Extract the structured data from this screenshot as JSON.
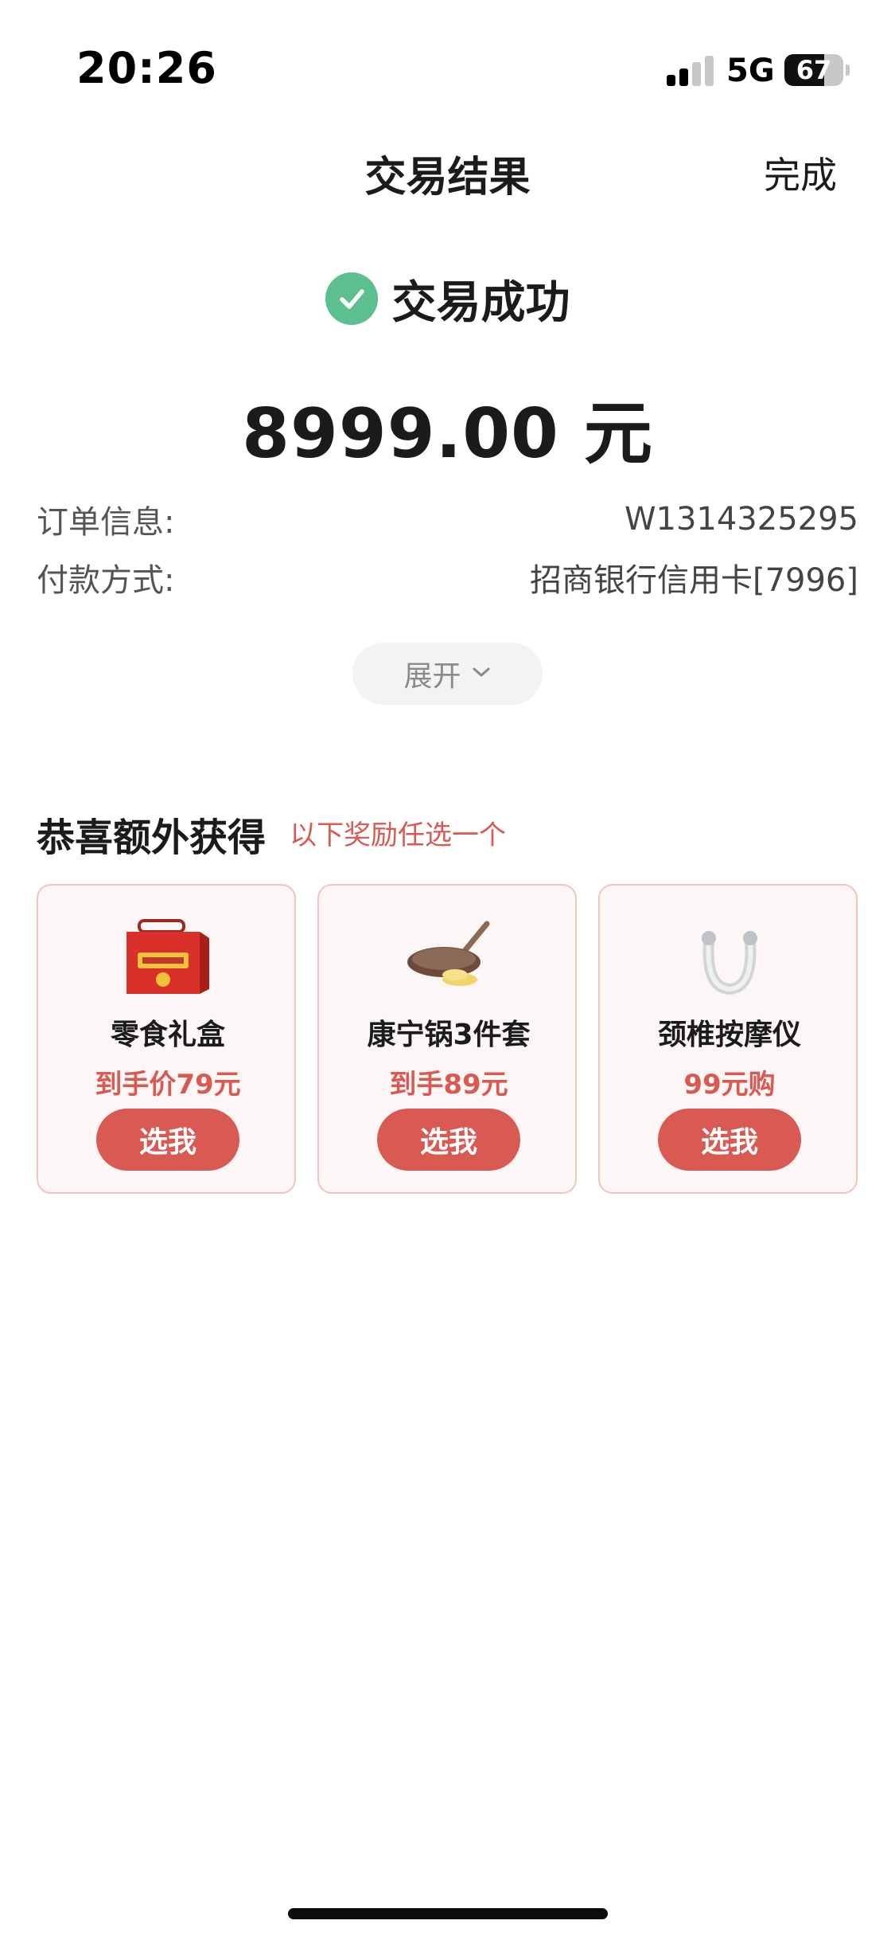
{
  "status_bar": {
    "time": "20:26",
    "network": "5G",
    "battery": "67",
    "battery_level_percent": 67
  },
  "nav": {
    "title": "交易结果",
    "done_label": "完成"
  },
  "result": {
    "status_text": "交易成功",
    "amount": "8999.00 元",
    "success_color": "#5cbf8f"
  },
  "info": {
    "order_label": "订单信息:",
    "order_value": "W1314325295",
    "payment_label": "付款方式:",
    "payment_value": "招商银行信用卡[7996]"
  },
  "expand": {
    "label": "展开",
    "icon": "chevron-down-icon"
  },
  "rewards": {
    "title": "恭喜额外获得",
    "subtitle": "以下奖励任选一个",
    "accent_color": "#d95a52",
    "items": [
      {
        "name": "零食礼盒",
        "price": "到手价79元",
        "button": "选我",
        "image": "snack-gift-box-image"
      },
      {
        "name": "康宁锅3件套",
        "price": "到手89元",
        "button": "选我",
        "image": "frying-pan-image"
      },
      {
        "name": "颈椎按摩仪",
        "price": "99元购",
        "button": "选我",
        "image": "neck-massager-image"
      }
    ]
  }
}
